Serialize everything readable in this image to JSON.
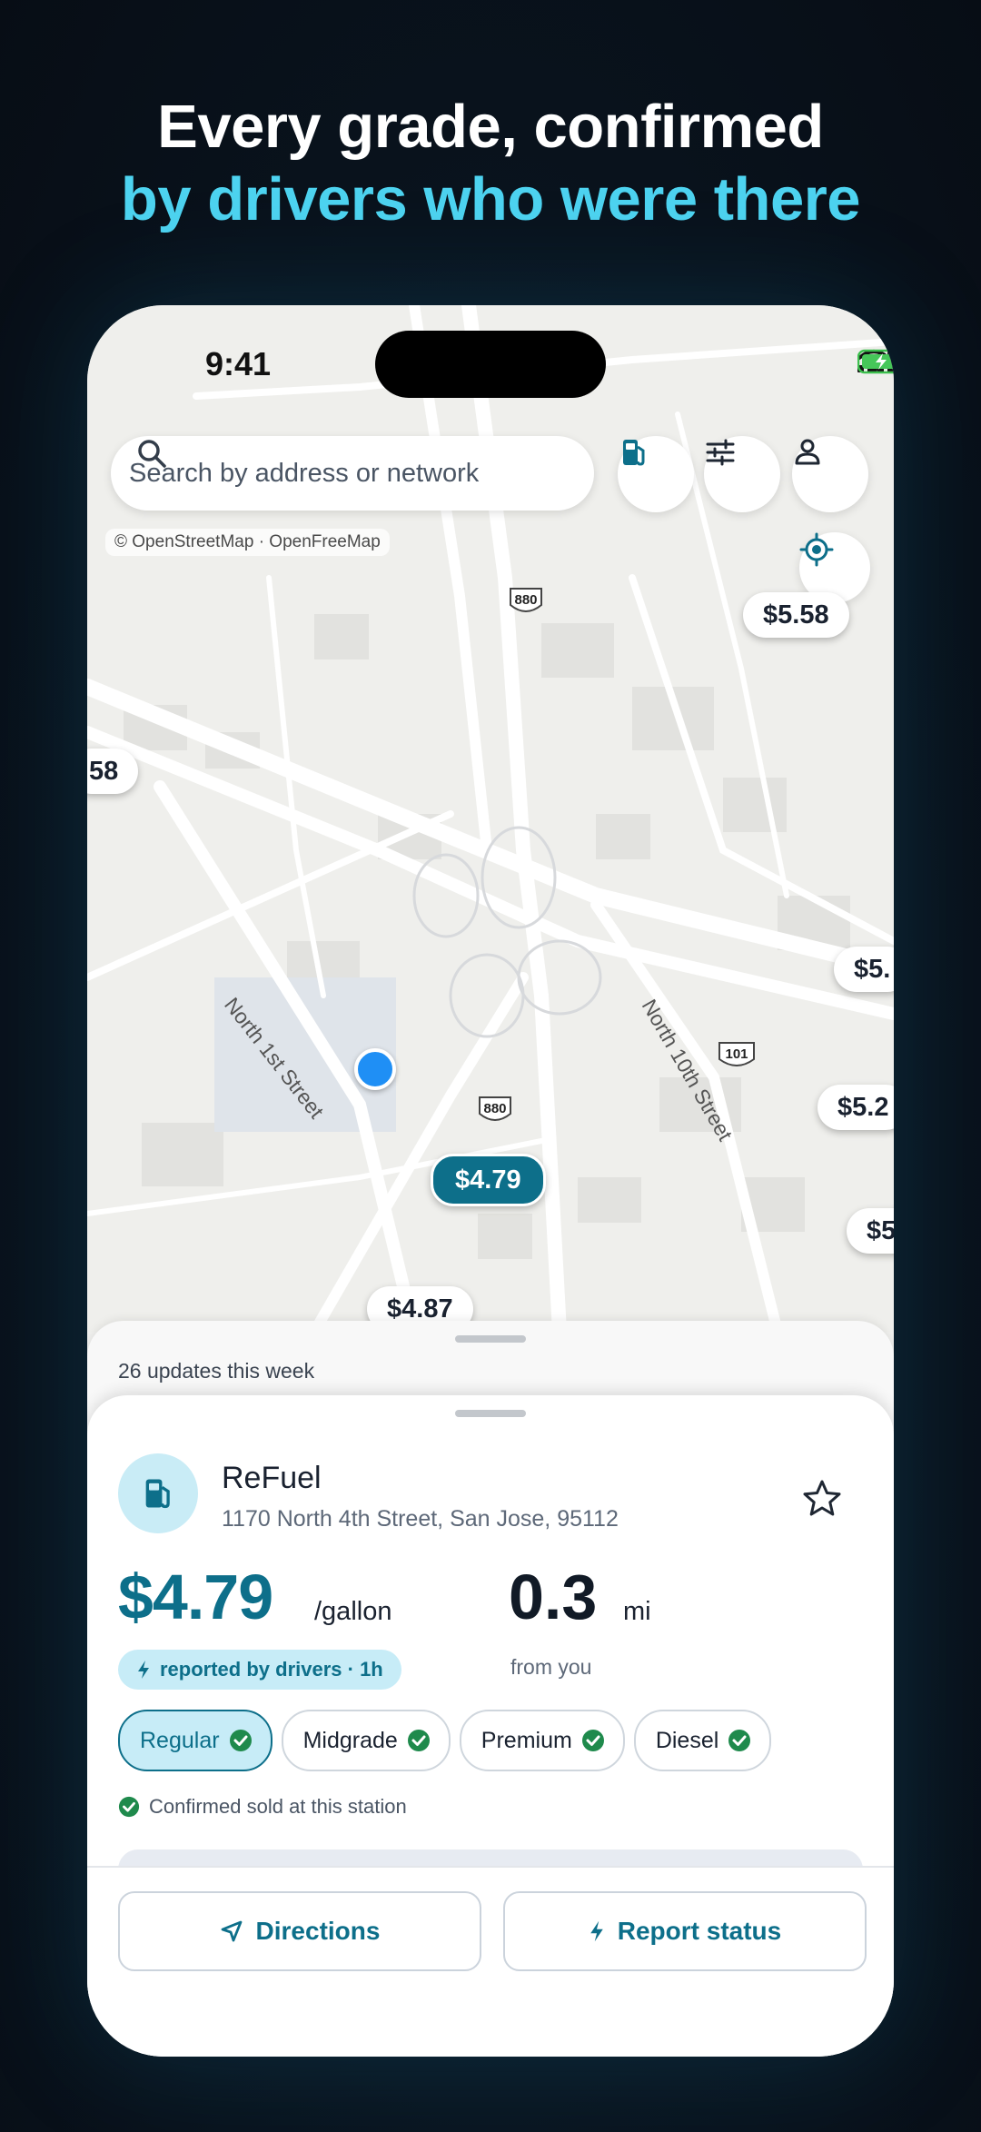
{
  "headline": {
    "line1": "Every grade, confirmed",
    "line2": "by drivers who were there"
  },
  "status_bar": {
    "time": "9:41"
  },
  "search": {
    "placeholder": "Search by address or network"
  },
  "map": {
    "attribution": "© OpenStreetMap · OpenFreeMap",
    "street_labels": [
      "North 1st Street",
      "North 10th Street"
    ],
    "highway_shields": [
      "880",
      "880",
      "101"
    ],
    "price_pins": [
      {
        "label": "$5.58"
      },
      {
        "label": "58"
      },
      {
        "label": "$5."
      },
      {
        "label": "$5.2"
      },
      {
        "label": "$5"
      },
      {
        "label": "$4.79",
        "selected": true
      },
      {
        "label": "$4.87"
      }
    ]
  },
  "sheet": {
    "updates_label": "26 updates this week",
    "station_name": "ReFuel",
    "station_address": "1170 North 4th Street, San Jose, 95112",
    "price": "$4.79",
    "price_unit": "/gallon",
    "distance": "0.3",
    "distance_unit": "mi",
    "distance_caption": "from you",
    "reported_badge": "reported by drivers · 1h",
    "grades": [
      {
        "label": "Regular",
        "selected": true
      },
      {
        "label": "Midgrade",
        "selected": false
      },
      {
        "label": "Premium",
        "selected": false
      },
      {
        "label": "Diesel",
        "selected": false
      }
    ],
    "confirmation": "Confirmed sold at this station",
    "directions_label": "Directions",
    "report_label": "Report status"
  },
  "colors": {
    "accent": "#0d6f8a",
    "headline_highlight": "#4dd3f0",
    "confirm_green": "#1f8a4c",
    "user_location": "#1f8ff5"
  },
  "icons": [
    "search-icon",
    "fuel-pump-icon",
    "filter-sliders-icon",
    "profile-icon",
    "locate-icon",
    "star-icon",
    "bolt-icon",
    "check-circle-icon",
    "navigation-arrow-icon"
  ]
}
